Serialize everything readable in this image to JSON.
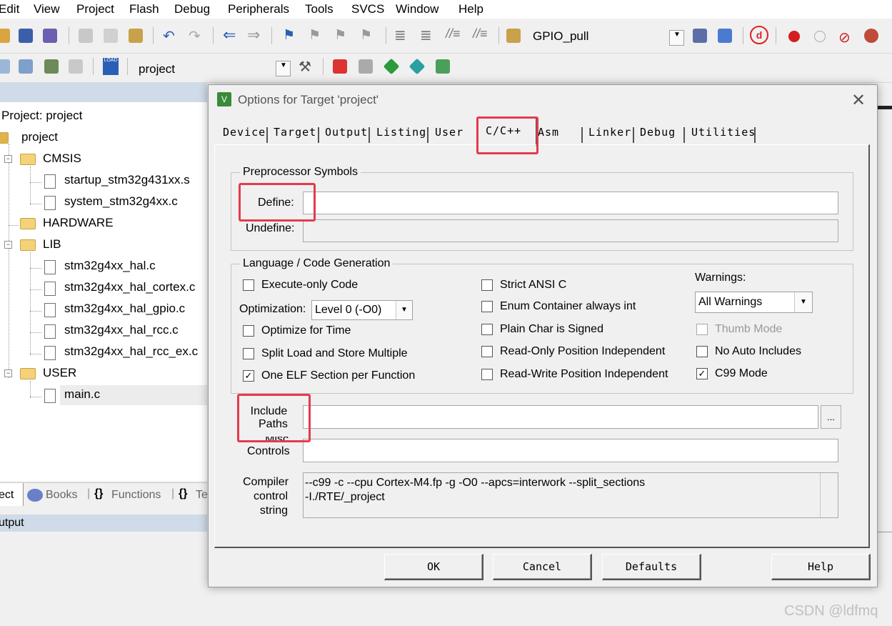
{
  "menu": [
    "Edit",
    "View",
    "Project",
    "Flash",
    "Debug",
    "Peripherals",
    "Tools",
    "SVCS",
    "Window",
    "Help"
  ],
  "toolbar1": {
    "target_combo": "GPIO_pull"
  },
  "toolbar2": {
    "project_combo": "project"
  },
  "project_panel": {
    "header": "Project: project",
    "root": "project",
    "tree": [
      {
        "label": "CMSIS",
        "type": "folder",
        "level": 1
      },
      {
        "label": "startup_stm32g431xx.s",
        "type": "file",
        "level": 2
      },
      {
        "label": "system_stm32g4xx.c",
        "type": "file",
        "level": 2
      },
      {
        "label": "HARDWARE",
        "type": "folder",
        "level": 1
      },
      {
        "label": "LIB",
        "type": "folder",
        "level": 1
      },
      {
        "label": "stm32g4xx_hal.c",
        "type": "file",
        "level": 2
      },
      {
        "label": "stm32g4xx_hal_cortex.c",
        "type": "file",
        "level": 2
      },
      {
        "label": "stm32g4xx_hal_gpio.c",
        "type": "file",
        "level": 2
      },
      {
        "label": "stm32g4xx_hal_rcc.c",
        "type": "file",
        "level": 2
      },
      {
        "label": "stm32g4xx_hal_rcc_ex.c",
        "type": "file",
        "level": 2
      },
      {
        "label": "USER",
        "type": "folder",
        "level": 1
      },
      {
        "label": "main.c",
        "type": "file",
        "level": 2
      }
    ],
    "bottom_tabs": [
      "ect",
      "Books",
      "Functions",
      "Te"
    ],
    "output_label": "utput"
  },
  "dialog": {
    "title": "Options for Target 'project'",
    "tabs": [
      "Device",
      "Target",
      "Output",
      "Listing",
      "User",
      "C/C++",
      "Asm",
      "Linker",
      "Debug",
      "Utilities"
    ],
    "active_tab": "C/C++",
    "preprocessor": {
      "group_title": "Preprocessor Symbols",
      "define_label": "Define:",
      "define_value": "",
      "undefine_label": "Undefine:",
      "undefine_value": ""
    },
    "language": {
      "group_title": "Language / Code Generation",
      "execute_only": "Execute-only Code",
      "optimization_label": "Optimization:",
      "optimization_value": "Level 0 (-O0)",
      "optimize_time": "Optimize for Time",
      "split_load": "Split Load and Store Multiple",
      "one_elf": "One ELF Section per Function",
      "strict_ansi": "Strict ANSI C",
      "enum_container": "Enum Container always int",
      "plain_char": "Plain Char is Signed",
      "ro_pi": "Read-Only Position Independent",
      "rw_pi": "Read-Write Position Independent",
      "warnings_label": "Warnings:",
      "warnings_value": "All Warnings",
      "thumb_mode": "Thumb Mode",
      "no_auto_includes": "No Auto Includes",
      "c99_mode": "C99 Mode"
    },
    "include_label_line1": "Include",
    "include_label_line2": "Paths",
    "include_value": "",
    "browse_label": "...",
    "misc_label_line1": "Misc",
    "misc_label_line2": "Controls",
    "misc_value": "",
    "compiler_label_line1": "Compiler",
    "compiler_label_line2": "control",
    "compiler_label_line3": "string",
    "compiler_string_line1": "--c99 -c --cpu Cortex-M4.fp -g -O0 --apcs=interwork --split_sections",
    "compiler_string_line2": "-I./RTE/_project",
    "buttons": {
      "ok": "OK",
      "cancel": "Cancel",
      "defaults": "Defaults",
      "help": "Help"
    }
  },
  "watermark": "CSDN @ldfmq",
  "colors": {
    "highlight": "#e23c4c"
  }
}
